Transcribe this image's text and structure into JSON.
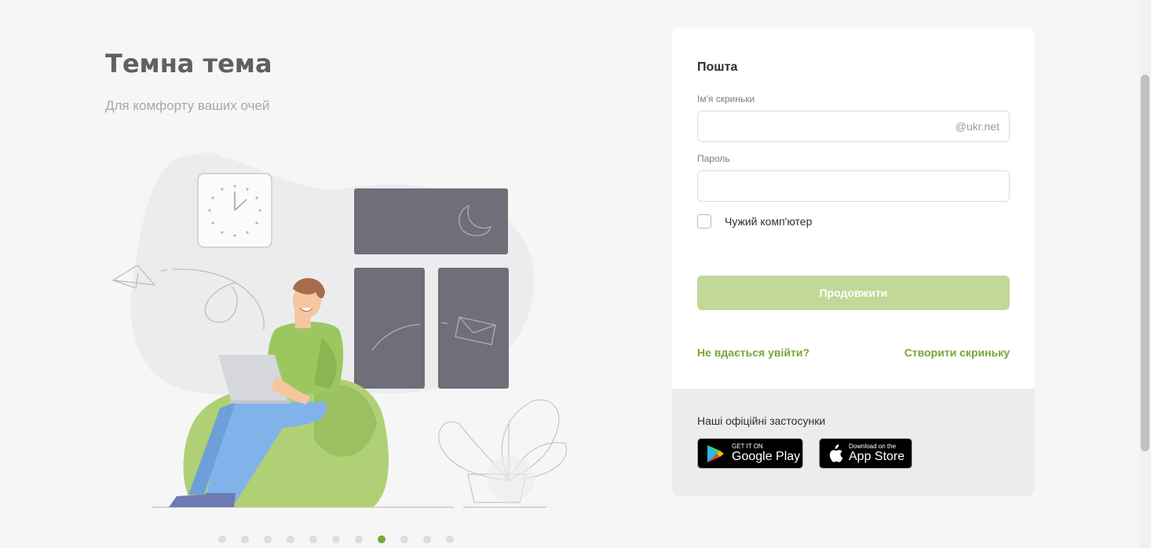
{
  "promo": {
    "title": "Темна тема",
    "subtitle": "Для комфорту ваших очей"
  },
  "carousel": {
    "total": 11,
    "active_index": 7
  },
  "login": {
    "title": "Пошта",
    "mailbox_label": "Ім'я скриньки",
    "mailbox_value": "",
    "mailbox_suffix": "@ukr.net",
    "password_label": "Пароль",
    "password_value": "",
    "foreign_computer_label": "Чужий комп'ютер",
    "foreign_computer_checked": false,
    "continue_label": "Продовжити",
    "cant_login_link": "Не вдається увійти?",
    "create_mailbox_link": "Створити скриньку"
  },
  "apps": {
    "title": "Наші офіційні застосунки",
    "google_play": {
      "small": "GET IT ON",
      "large": "Google Play"
    },
    "app_store": {
      "small": "Download on the",
      "large": "App Store"
    }
  },
  "colors": {
    "accent": "#76a833",
    "button_disabled": "#c1d898",
    "window_dark": "#6f6f7a",
    "bag_green": "#afd075",
    "pants_blue": "#82b2ea"
  }
}
